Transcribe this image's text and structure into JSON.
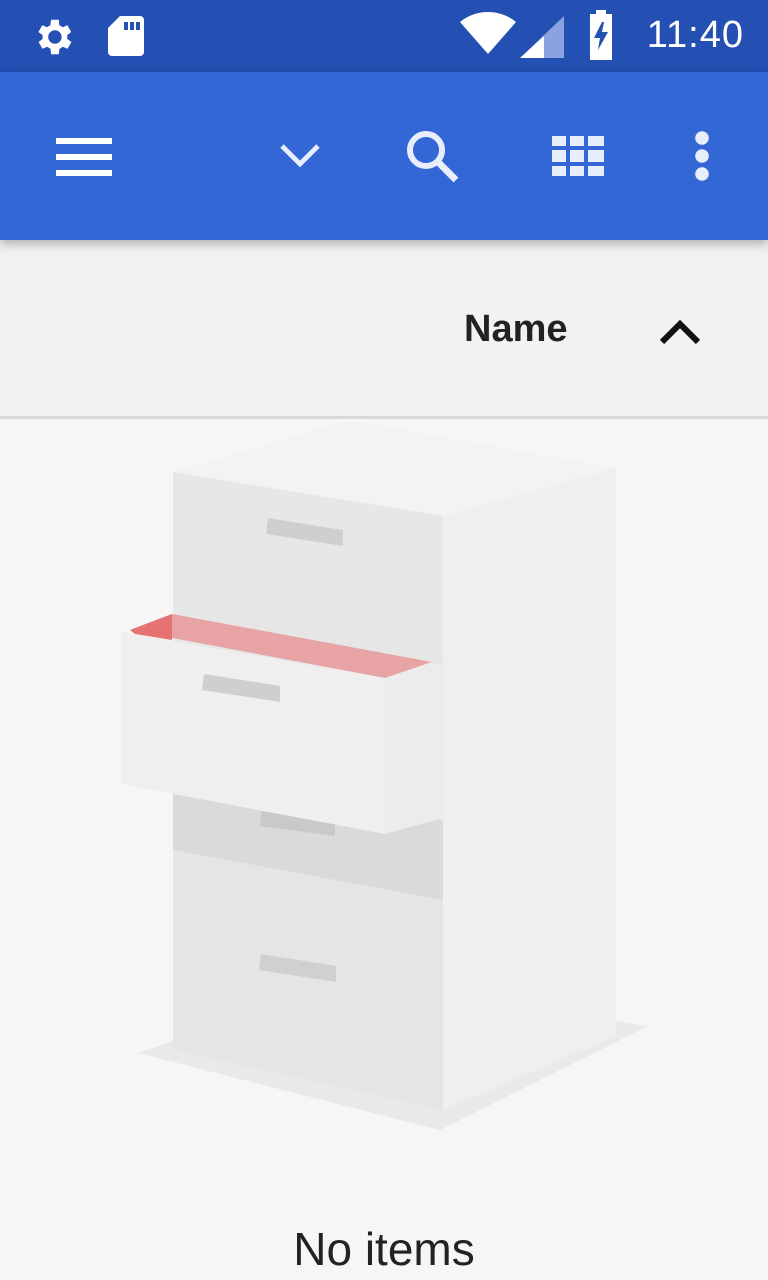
{
  "status_bar": {
    "time": "11:40",
    "icons": [
      "settings-icon",
      "sd-card-icon",
      "wifi-icon",
      "signal-icon",
      "battery-charging-icon"
    ]
  },
  "app_bar": {
    "icons": [
      "menu-icon",
      "chevron-down-icon",
      "search-icon",
      "grid-view-icon",
      "more-vert-icon"
    ],
    "background": "#3367d6"
  },
  "sort_bar": {
    "label": "Name",
    "direction_icon": "chevron-up-icon"
  },
  "empty_state": {
    "illustration": "file-cabinet-illustration",
    "message": "No items"
  },
  "colors": {
    "status_bar": "#2450b4",
    "app_bar": "#3367d6",
    "background": "#f6f6f6",
    "drawer_accent": "#e88a8a"
  }
}
